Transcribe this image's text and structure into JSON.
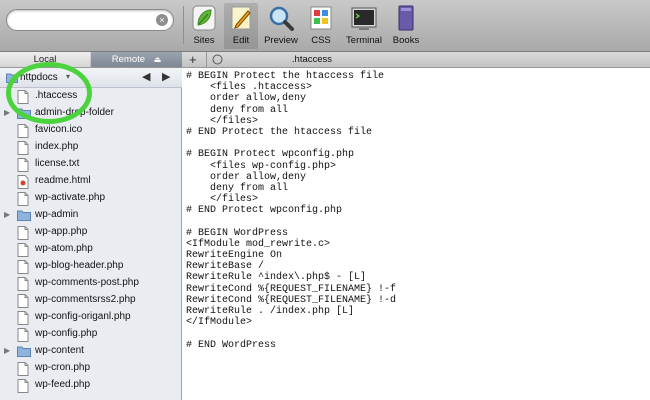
{
  "toolbar": {
    "items": [
      {
        "label": "Sites",
        "icon": "leaf-icon"
      },
      {
        "label": "Edit",
        "icon": "pencil-icon"
      },
      {
        "label": "Preview",
        "icon": "magnifier-icon"
      },
      {
        "label": "CSS",
        "icon": "css-palette-icon"
      },
      {
        "label": "Terminal",
        "icon": "terminal-icon"
      },
      {
        "label": "Books",
        "icon": "books-icon"
      }
    ],
    "search": {
      "value": ""
    },
    "clear_symbol": "×"
  },
  "left_panel": {
    "tabs": {
      "local": "Local",
      "remote": "Remote",
      "remote_eject": "⏏"
    },
    "path": {
      "name": "httpdocs",
      "caret": "▾",
      "back": "◀",
      "forward": "▶"
    },
    "files": [
      {
        "name": ".htaccess",
        "type": "file"
      },
      {
        "name": "admin-drop-folder",
        "type": "folder"
      },
      {
        "name": "favicon.ico",
        "type": "file"
      },
      {
        "name": "index.php",
        "type": "file"
      },
      {
        "name": "license.txt",
        "type": "file"
      },
      {
        "name": "readme.html",
        "type": "html"
      },
      {
        "name": "wp-activate.php",
        "type": "file"
      },
      {
        "name": "wp-admin",
        "type": "folder"
      },
      {
        "name": "wp-app.php",
        "type": "file"
      },
      {
        "name": "wp-atom.php",
        "type": "file"
      },
      {
        "name": "wp-blog-header.php",
        "type": "file"
      },
      {
        "name": "wp-comments-post.php",
        "type": "file"
      },
      {
        "name": "wp-commentsrss2.php",
        "type": "file"
      },
      {
        "name": "wp-config-origanl.php",
        "type": "file"
      },
      {
        "name": "wp-config.php",
        "type": "file"
      },
      {
        "name": "wp-content",
        "type": "folder"
      },
      {
        "name": "wp-cron.php",
        "type": "file"
      },
      {
        "name": "wp-feed.php",
        "type": "file"
      }
    ]
  },
  "editor": {
    "tab_add": "+",
    "tab_title": ".htaccess",
    "lines": [
      "# BEGIN Protect the htaccess file",
      "    <files .htaccess>",
      "    order allow,deny",
      "    deny from all",
      "    </files>",
      "# END Protect the htaccess file",
      "",
      "# BEGIN Protect wpconfig.php",
      "    <files wp-config.php>",
      "    order allow,deny",
      "    deny from all",
      "    </files>",
      "# END Protect wpconfig.php",
      "",
      "# BEGIN WordPress",
      "<IfModule mod_rewrite.c>",
      "RewriteEngine On",
      "RewriteBase /",
      "RewriteRule ^index\\.php$ - [L]",
      "RewriteCond %{REQUEST_FILENAME} !-f",
      "RewriteCond %{REQUEST_FILENAME} !-d",
      "RewriteRule . /index.php [L]",
      "</IfModule>",
      "",
      "# END WordPress"
    ]
  },
  "colors": {
    "highlight_circle": "#4bd33d",
    "sidebar_bg": "#e9edf2"
  }
}
